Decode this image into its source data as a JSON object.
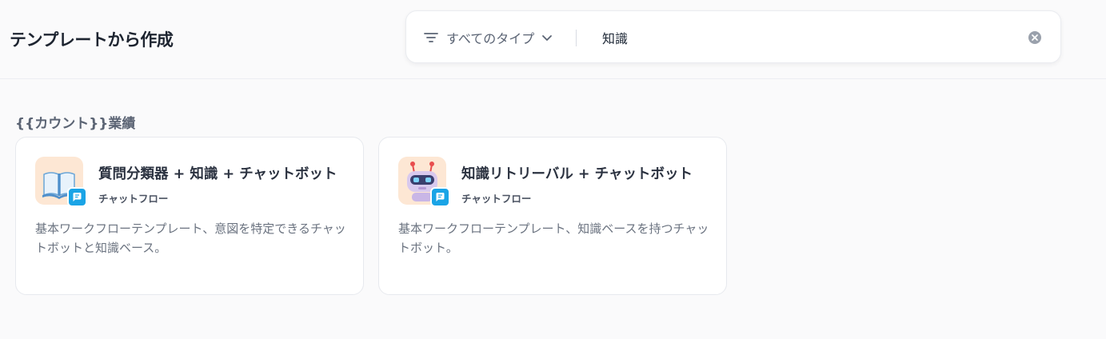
{
  "header": {
    "title": "テンプレートから作成"
  },
  "search": {
    "type_filter_label": "すべてのタイプ",
    "query": "知識"
  },
  "section": {
    "title": "{{カウント}}業績"
  },
  "cards": [
    {
      "title": "質問分類器 + 知識 + チャットボット",
      "type": "チャットフロー",
      "description": "基本ワークフローテンプレート、意図を特定できるチャットボットと知識ベース。",
      "icon": "book-icon"
    },
    {
      "title": "知識リトリーバル + チャットボット",
      "type": "チャットフロー",
      "description": "基本ワークフローテンプレート、知識ベースを持つチャットボット。",
      "icon": "robot-icon"
    }
  ],
  "colors": {
    "accent": "#1aa4e6",
    "icon_bg": "#fde7d4"
  }
}
